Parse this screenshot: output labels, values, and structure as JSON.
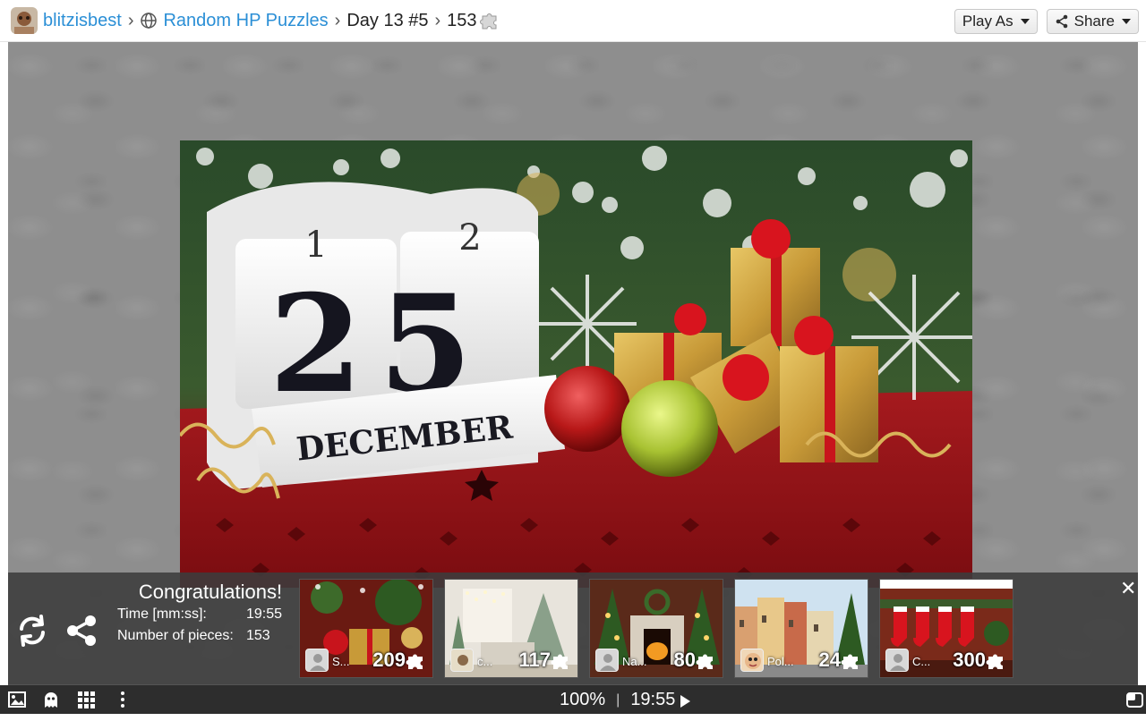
{
  "header": {
    "user": "blitzisbest",
    "collection": "Random HP Puzzles",
    "puzzle_title": "Day 13 #5",
    "pieces": "153",
    "play_as_label": "Play As",
    "share_label": "Share"
  },
  "puzzle_image": {
    "top_digit_left": "1",
    "top_digit_right": "2",
    "day": "25",
    "month": "DECEMBER"
  },
  "congrats": {
    "title": "Congratulations!",
    "time_label": "Time [mm:ss]:",
    "time_value": "19:55",
    "pieces_label": "Number of pieces:",
    "pieces_value": "153"
  },
  "suggestions": [
    {
      "user": "S...",
      "pieces": "209"
    },
    {
      "user": "c...",
      "pieces": "117"
    },
    {
      "user": "Na...",
      "pieces": "80"
    },
    {
      "user": "Pol...",
      "pieces": "24"
    },
    {
      "user": "C...",
      "pieces": "300"
    }
  ],
  "status": {
    "zoom": "100%",
    "separator": "|",
    "timer": "19:55"
  },
  "colors": {
    "link": "#2b8fd6",
    "panel": "#3c3c3c",
    "stage": "#8e8e8e",
    "puzzle_red": "#b3121c"
  }
}
